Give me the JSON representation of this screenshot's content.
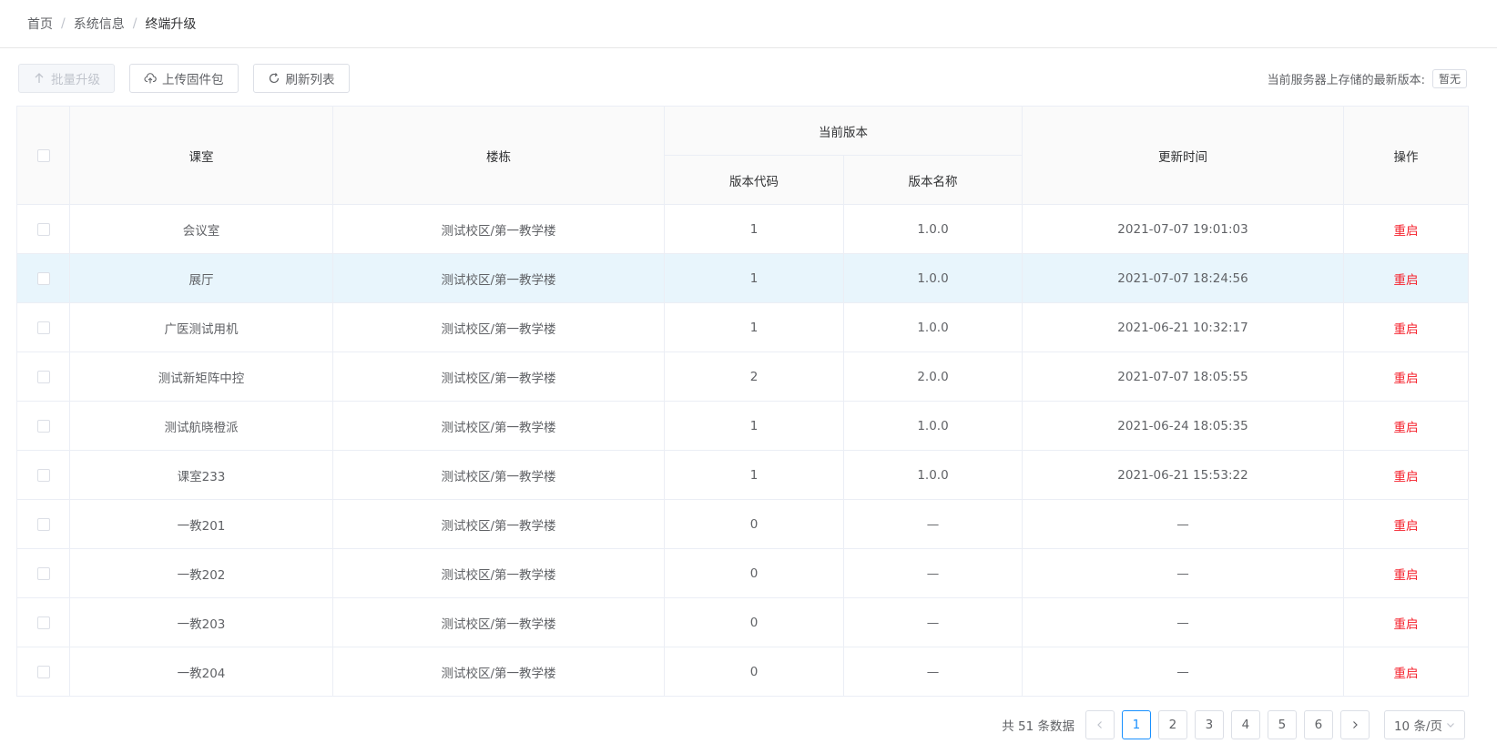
{
  "breadcrumb": [
    "首页",
    "系统信息",
    "终端升级"
  ],
  "breadcrumb_separator": "/",
  "toolbar": {
    "batch_upgrade": "批量升级",
    "upload_firmware": "上传固件包",
    "refresh_list": "刷新列表"
  },
  "server_version": {
    "label": "当前服务器上存储的最新版本:",
    "value": "暂无"
  },
  "table": {
    "headers": {
      "classroom": "课室",
      "building": "楼栋",
      "current_version": "当前版本",
      "version_code": "版本代码",
      "version_name": "版本名称",
      "update_time": "更新时间",
      "actions": "操作"
    },
    "rows": [
      {
        "classroom": "会议室",
        "building": "测试校区/第一教学楼",
        "code": "1",
        "name": "1.0.0",
        "time": "2021-07-07 19:01:03",
        "action": "重启"
      },
      {
        "classroom": "展厅",
        "building": "测试校区/第一教学楼",
        "code": "1",
        "name": "1.0.0",
        "time": "2021-07-07 18:24:56",
        "action": "重启"
      },
      {
        "classroom": "广医测试用机",
        "building": "测试校区/第一教学楼",
        "code": "1",
        "name": "1.0.0",
        "time": "2021-06-21 10:32:17",
        "action": "重启"
      },
      {
        "classroom": "测试新矩阵中控",
        "building": "测试校区/第一教学楼",
        "code": "2",
        "name": "2.0.0",
        "time": "2021-07-07 18:05:55",
        "action": "重启"
      },
      {
        "classroom": "测试航晓橙派",
        "building": "测试校区/第一教学楼",
        "code": "1",
        "name": "1.0.0",
        "time": "2021-06-24 18:05:35",
        "action": "重启"
      },
      {
        "classroom": "课室233",
        "building": "测试校区/第一教学楼",
        "code": "1",
        "name": "1.0.0",
        "time": "2021-06-21 15:53:22",
        "action": "重启"
      },
      {
        "classroom": "一教201",
        "building": "测试校区/第一教学楼",
        "code": "0",
        "name": "—",
        "time": "—",
        "action": "重启"
      },
      {
        "classroom": "一教202",
        "building": "测试校区/第一教学楼",
        "code": "0",
        "name": "—",
        "time": "—",
        "action": "重启"
      },
      {
        "classroom": "一教203",
        "building": "测试校区/第一教学楼",
        "code": "0",
        "name": "—",
        "time": "—",
        "action": "重启"
      },
      {
        "classroom": "一教204",
        "building": "测试校区/第一教学楼",
        "code": "0",
        "name": "—",
        "time": "—",
        "action": "重启"
      }
    ]
  },
  "pagination": {
    "total_text": "共 51 条数据",
    "pages": [
      "1",
      "2",
      "3",
      "4",
      "5",
      "6"
    ],
    "current_page": "1",
    "page_size": "10 条/页"
  },
  "colors": {
    "accent": "#1890ff",
    "danger": "#f5222d",
    "row_highlight": "#e8f5fc"
  }
}
